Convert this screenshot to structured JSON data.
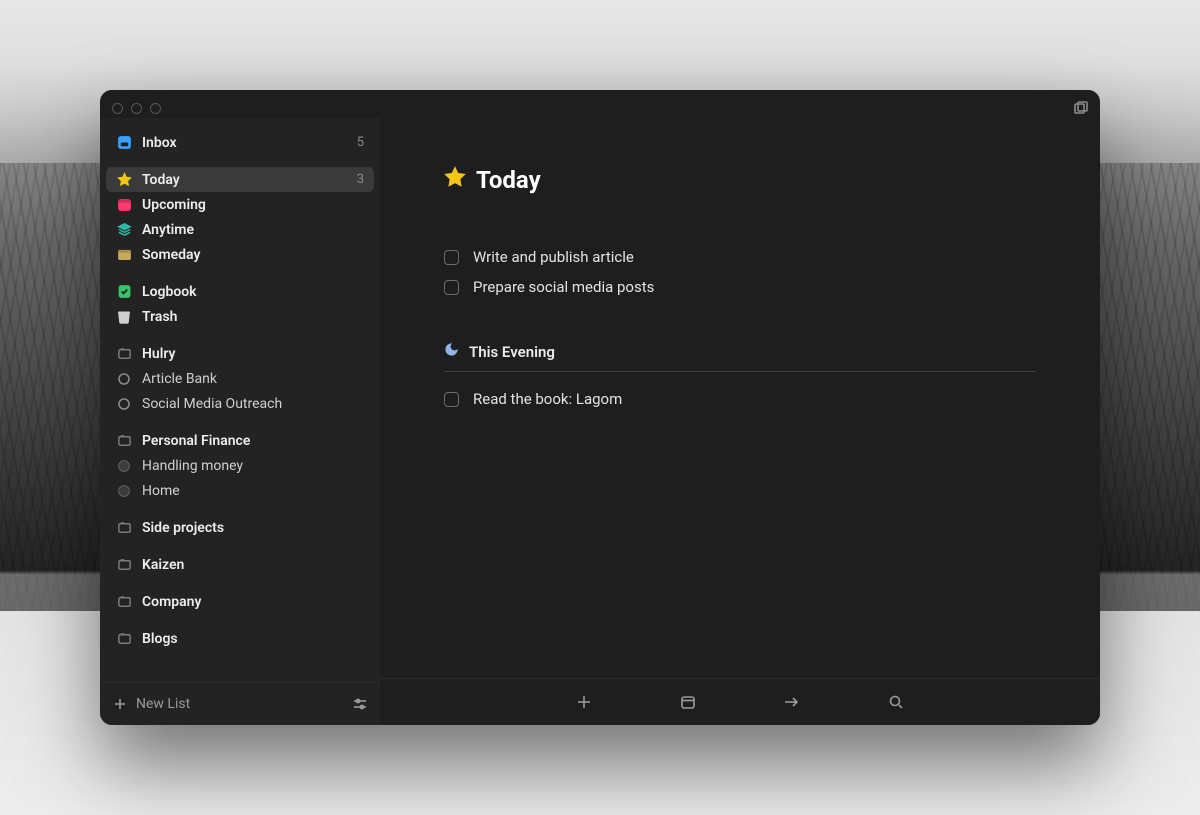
{
  "sidebar": {
    "sections": [
      [
        {
          "key": "inbox",
          "label": "Inbox",
          "count": "5",
          "icon": "inbox",
          "bold": true
        }
      ],
      [
        {
          "key": "today",
          "label": "Today",
          "count": "3",
          "icon": "star",
          "bold": true,
          "selected": true
        },
        {
          "key": "upcoming",
          "label": "Upcoming",
          "icon": "calendar",
          "bold": true
        },
        {
          "key": "anytime",
          "label": "Anytime",
          "icon": "stack",
          "bold": true
        },
        {
          "key": "someday",
          "label": "Someday",
          "icon": "archive",
          "bold": true
        }
      ],
      [
        {
          "key": "logbook",
          "label": "Logbook",
          "icon": "logbook",
          "bold": true
        },
        {
          "key": "trash",
          "label": "Trash",
          "icon": "trash",
          "bold": true
        }
      ],
      [
        {
          "key": "hulry",
          "label": "Hulry",
          "icon": "area",
          "bold": true
        },
        {
          "key": "article-bank",
          "label": "Article Bank",
          "icon": "project"
        },
        {
          "key": "social-outreach",
          "label": "Social Media Outreach",
          "icon": "project"
        }
      ],
      [
        {
          "key": "personal-finance",
          "label": "Personal Finance",
          "icon": "area",
          "bold": true
        },
        {
          "key": "handling-money",
          "label": "Handling money",
          "icon": "project-dim"
        },
        {
          "key": "home",
          "label": "Home",
          "icon": "project-dim"
        }
      ],
      [
        {
          "key": "side-projects",
          "label": "Side projects",
          "icon": "area",
          "bold": true
        }
      ],
      [
        {
          "key": "kaizen",
          "label": "Kaizen",
          "icon": "area",
          "bold": true
        }
      ],
      [
        {
          "key": "company",
          "label": "Company",
          "icon": "area",
          "bold": true
        }
      ],
      [
        {
          "key": "blogs",
          "label": "Blogs",
          "icon": "area",
          "bold": true
        }
      ]
    ],
    "footer": {
      "newList": "New List"
    }
  },
  "main": {
    "title": "Today",
    "tasks": [
      {
        "label": "Write and publish article"
      },
      {
        "label": "Prepare social media posts"
      }
    ],
    "eveningHeader": "This Evening",
    "eveningTasks": [
      {
        "label": "Read the book: Lagom"
      }
    ]
  }
}
